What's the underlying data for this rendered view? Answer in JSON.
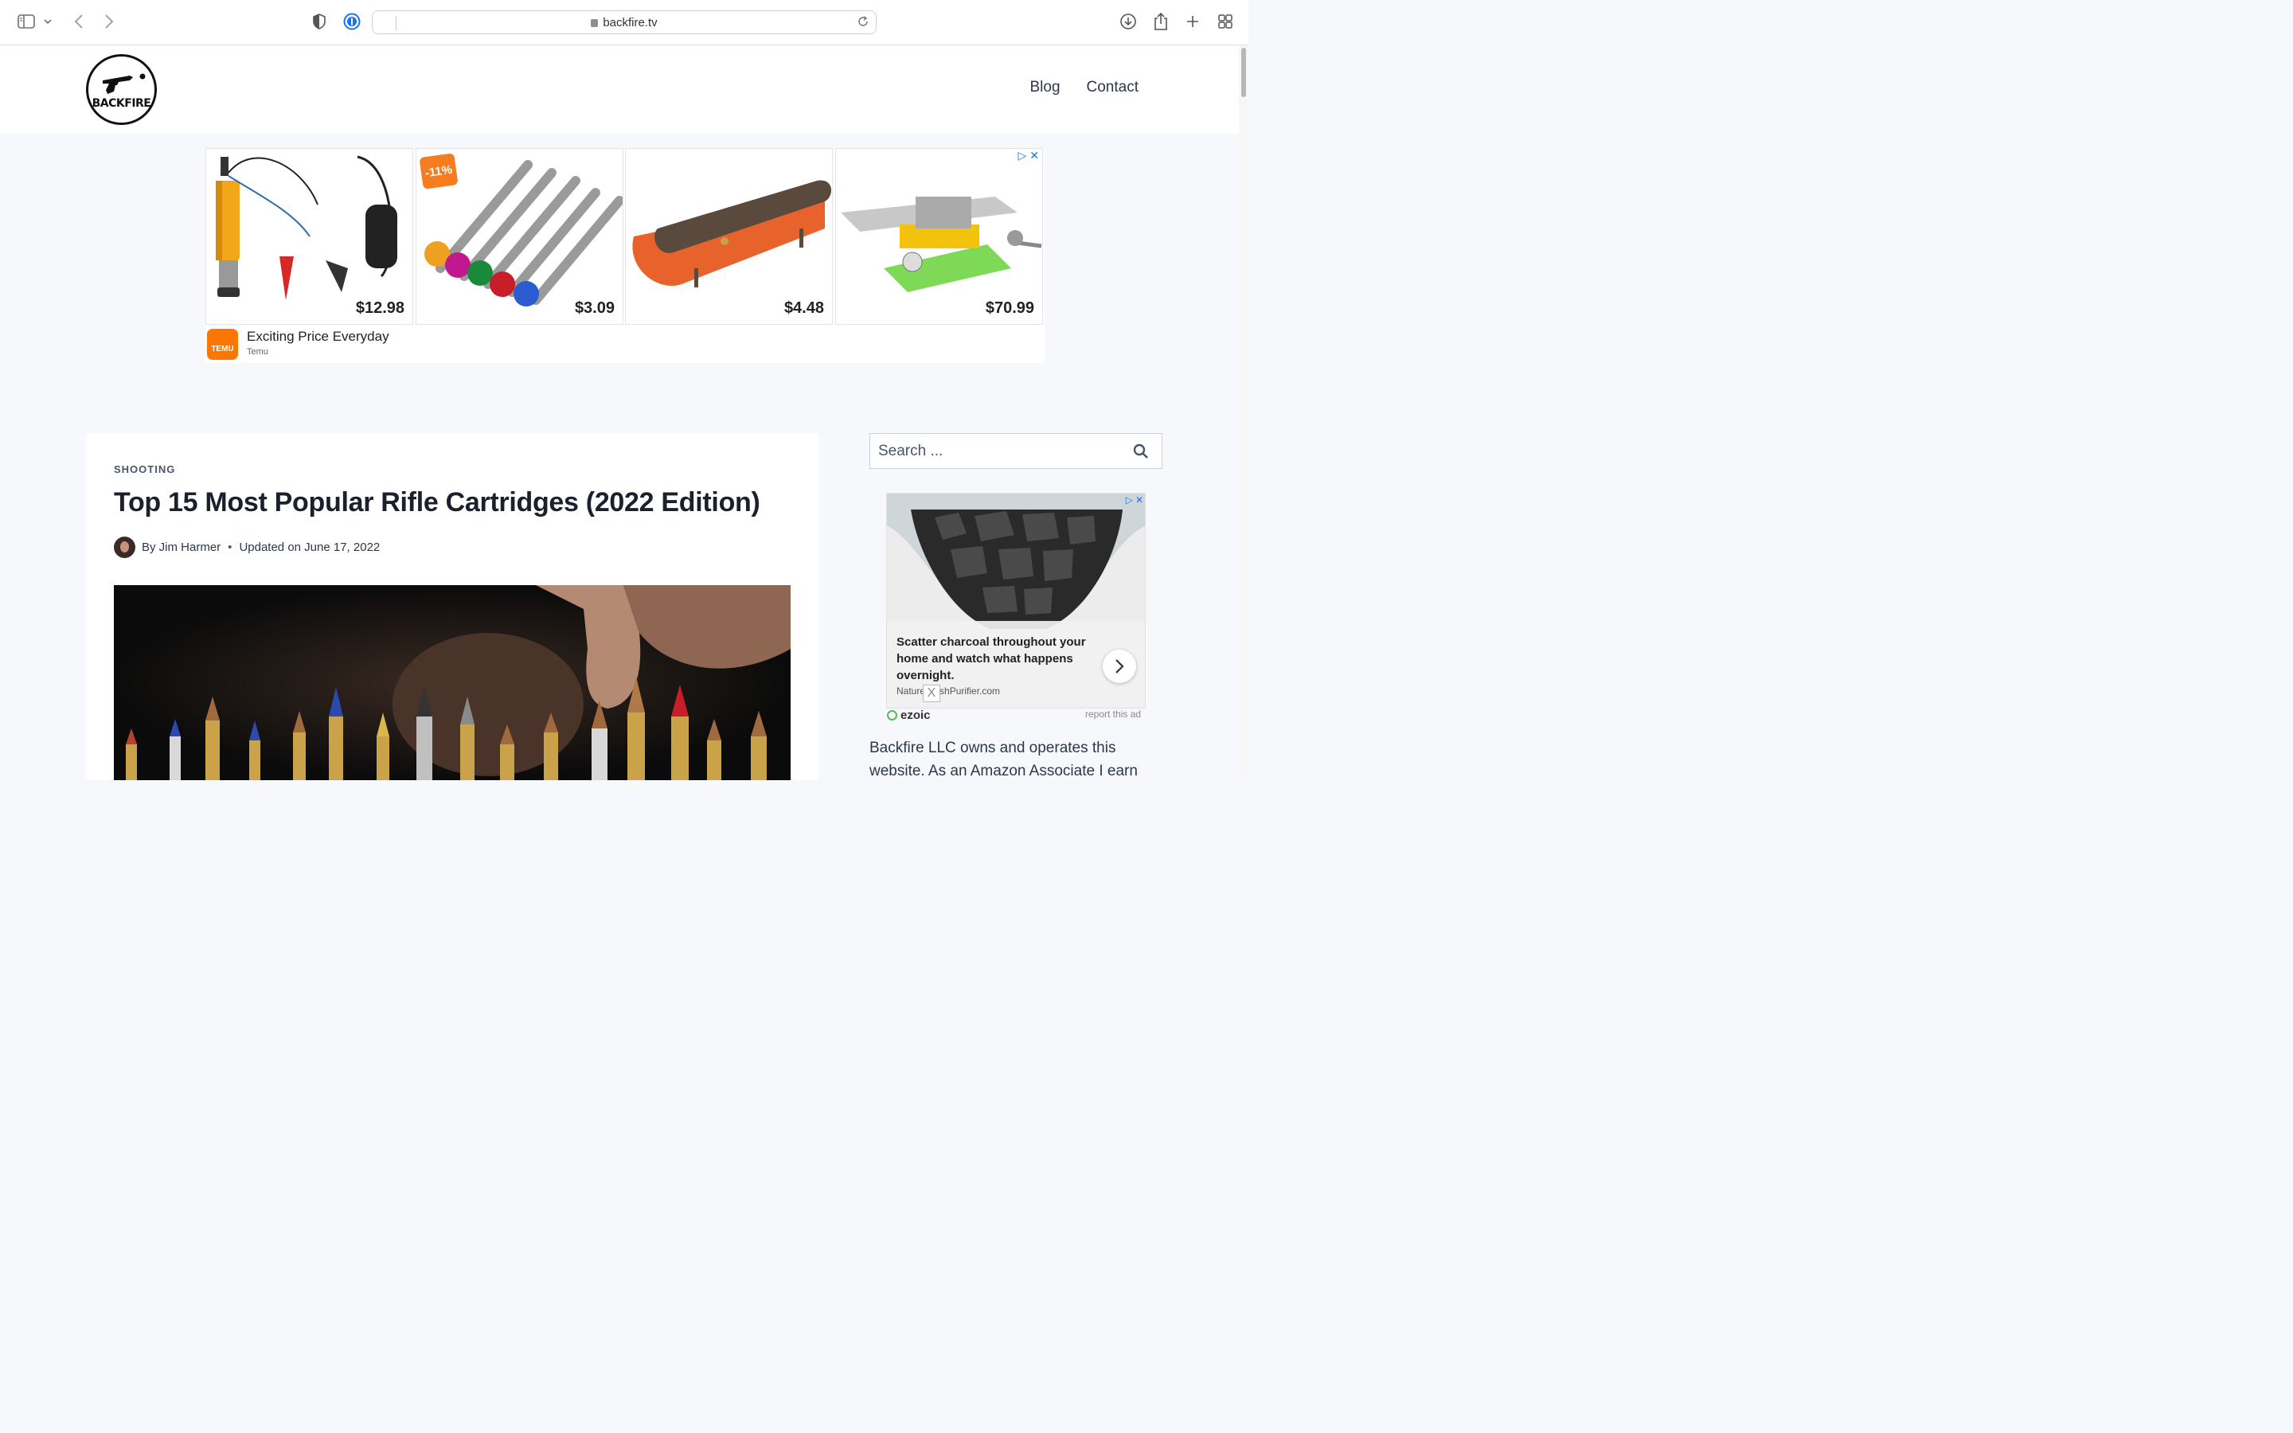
{
  "browser": {
    "url": "backfire.tv"
  },
  "site": {
    "logo_text": "BACKFIRE",
    "nav": [
      {
        "label": "Blog"
      },
      {
        "label": "Contact"
      }
    ]
  },
  "top_ad": {
    "products": [
      {
        "price": "$12.98",
        "icon": "pump-product"
      },
      {
        "price": "$3.09",
        "icon": "bits-product",
        "discount": "-11%"
      },
      {
        "price": "$4.48",
        "icon": "dispenser-product"
      },
      {
        "price": "$70.99",
        "icon": "vise-table-product"
      }
    ],
    "brand_logo": "TEMU",
    "headline": "Exciting Price Everyday",
    "brand": "Temu"
  },
  "article": {
    "category": "SHOOTING",
    "title": "Top 15 Most Popular Rifle Cartridges (2022 Edition)",
    "author": "By Jim Harmer",
    "updated": "Updated on June 17, 2022"
  },
  "sidebar": {
    "search": {
      "placeholder": "Search ..."
    },
    "ad": {
      "text": "Scatter charcoal throughout your home and watch what happens overnight.",
      "domain": "NatureFreshPurifier.com",
      "close_label": "X"
    },
    "ezoic_label": "ezoic",
    "report_label": "report this ad",
    "disclosure": "Backfire LLC owns and operates this website. As an Amazon Associate I earn"
  },
  "colors": {
    "accent": "#1a73e8",
    "temu_orange": "#fb7701",
    "page_bg": "#f6f8fb"
  }
}
